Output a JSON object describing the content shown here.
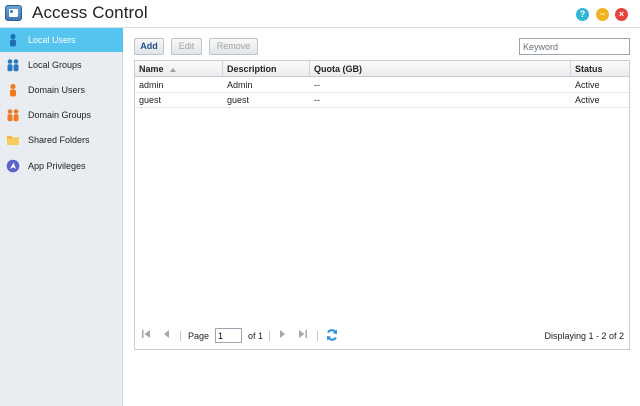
{
  "window": {
    "title": "Access Control",
    "controls": {
      "help": "?",
      "minimize": "−",
      "close": "×"
    }
  },
  "sidebar": {
    "items": [
      {
        "label": "Local Users",
        "icon": "user-icon",
        "active": true
      },
      {
        "label": "Local Groups",
        "icon": "users-icon",
        "active": false
      },
      {
        "label": "Domain Users",
        "icon": "domain-user-icon",
        "active": false
      },
      {
        "label": "Domain Groups",
        "icon": "domain-group-icon",
        "active": false
      },
      {
        "label": "Shared Folders",
        "icon": "folder-icon",
        "active": false
      },
      {
        "label": "App Privileges",
        "icon": "app-privileges-icon",
        "active": false
      }
    ]
  },
  "toolbar": {
    "add_label": "Add",
    "edit_label": "Edit",
    "remove_label": "Remove",
    "search_placeholder": "Keyword"
  },
  "table": {
    "columns": [
      "Name",
      "Description",
      "Quota (GB)",
      "Status"
    ],
    "rows": [
      [
        "admin",
        "Admin",
        "--",
        "Active"
      ],
      [
        "guest",
        "guest",
        "--",
        "Active"
      ]
    ]
  },
  "pager": {
    "page_label": "Page",
    "current_page": "1",
    "of_label": "of 1",
    "display_text": "Displaying 1 - 2 of 2"
  },
  "colors": {
    "accent": "#55c4ef",
    "sidebar_bg": "#e9edf1",
    "add_text": "#1f4e8c",
    "help": "#2fb6d6",
    "minimize": "#f2b323",
    "close": "#e6453c"
  }
}
